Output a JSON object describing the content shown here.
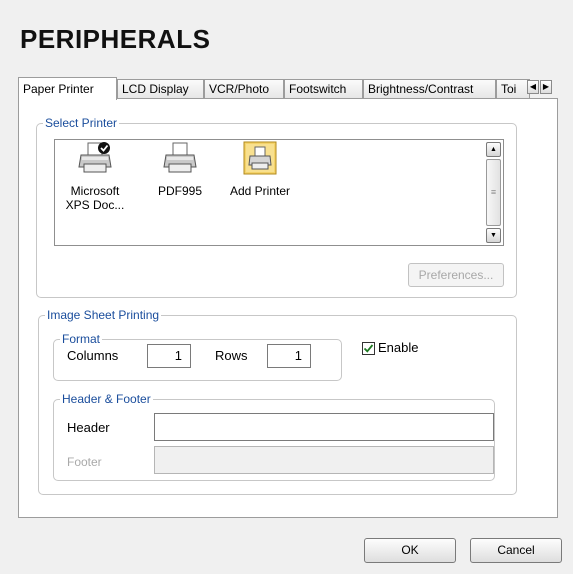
{
  "window": {
    "title": "PERIPHERALS"
  },
  "tabs": [
    "Paper Printer",
    "LCD Display",
    "VCR/Photo",
    "Footswitch",
    "Brightness/Contrast",
    "Toi"
  ],
  "active_tab": "Paper Printer",
  "select_printer": {
    "legend": "Select Printer",
    "printers": [
      {
        "label": "Microsoft XPS Doc...",
        "icon": "printer-default-icon"
      },
      {
        "label": "PDF995",
        "icon": "printer-icon"
      },
      {
        "label": "Add Printer",
        "icon": "add-printer-icon"
      }
    ],
    "preferences_label": "Preferences..."
  },
  "image_sheet": {
    "legend": "Image Sheet Printing",
    "format_legend": "Format",
    "columns_label": "Columns",
    "columns_value": "1",
    "rows_label": "Rows",
    "rows_value": "1",
    "enable_label": "Enable",
    "enable_checked": true,
    "header_footer_legend": "Header & Footer",
    "header_label": "Header",
    "header_value": "",
    "footer_label": "Footer",
    "footer_value": ""
  },
  "buttons": {
    "ok": "OK",
    "cancel": "Cancel"
  },
  "colors": {
    "legend": "#1a4d9c",
    "disabled_text": "#a9a9a9",
    "panel_bg": "#ffffff",
    "window_bg": "#f0f0f0"
  }
}
